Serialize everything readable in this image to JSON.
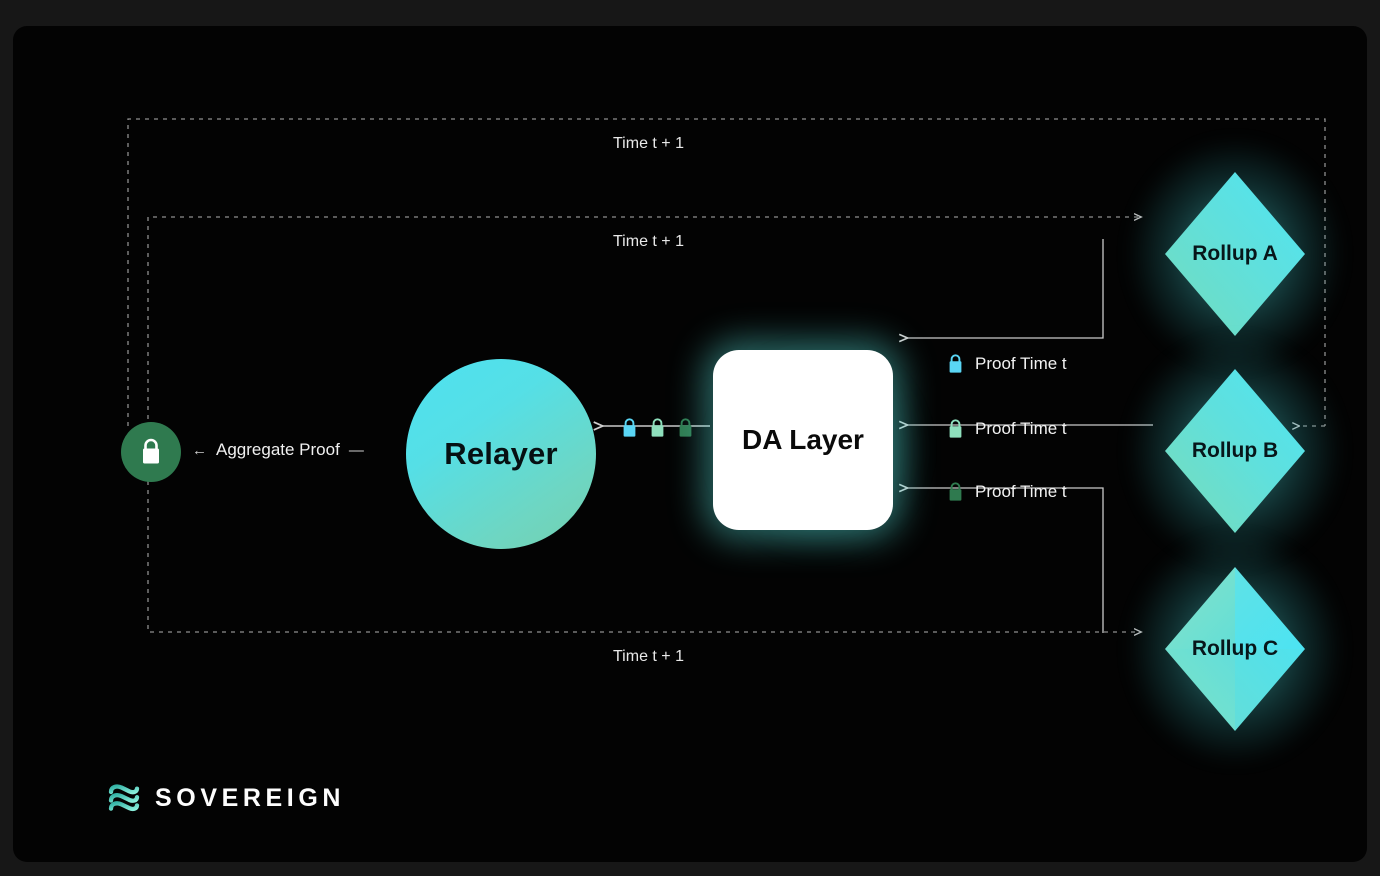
{
  "diagram": {
    "nodes": {
      "relayer": "Relayer",
      "da_layer": "DA Layer",
      "rollup_a": "Rollup A",
      "rollup_b": "Rollup B",
      "rollup_c": "Rollup C"
    },
    "edge_labels": {
      "aggregate_proof": "Aggregate Proof",
      "proof_a": "Proof Time t",
      "proof_b": "Proof Time t",
      "proof_c": "Proof Time t",
      "time_outer": "Time t + 1",
      "time_middle": "Time t + 1",
      "time_bottom": "Time t + 1"
    },
    "arrow_left": "←",
    "dash_mark": "—",
    "colors": {
      "background_outer": "#171717",
      "background_panel": "#030303",
      "lock_disc": "#2f7a4f",
      "lock_cyan": "#5ad6f5",
      "lock_mint": "#8fe0bd",
      "lock_green": "#2f7a4f",
      "rollup_cyan": "#58e6f0",
      "rollup_teal": "#76d8c0",
      "relayer_from": "#4ee2f0",
      "relayer_to": "#74cfae",
      "da_layer_fill": "#ffffff",
      "dashed_line": "#9a9a9a",
      "solid_line": "#cfcfcf",
      "text_light": "#f2f2f2",
      "brand_mark_from": "#3fbfae",
      "brand_mark_to": "#7fe6d2"
    }
  },
  "brand": {
    "wordmark": "SOVEREIGN",
    "mark_name": "sovereign-wave-logo"
  }
}
